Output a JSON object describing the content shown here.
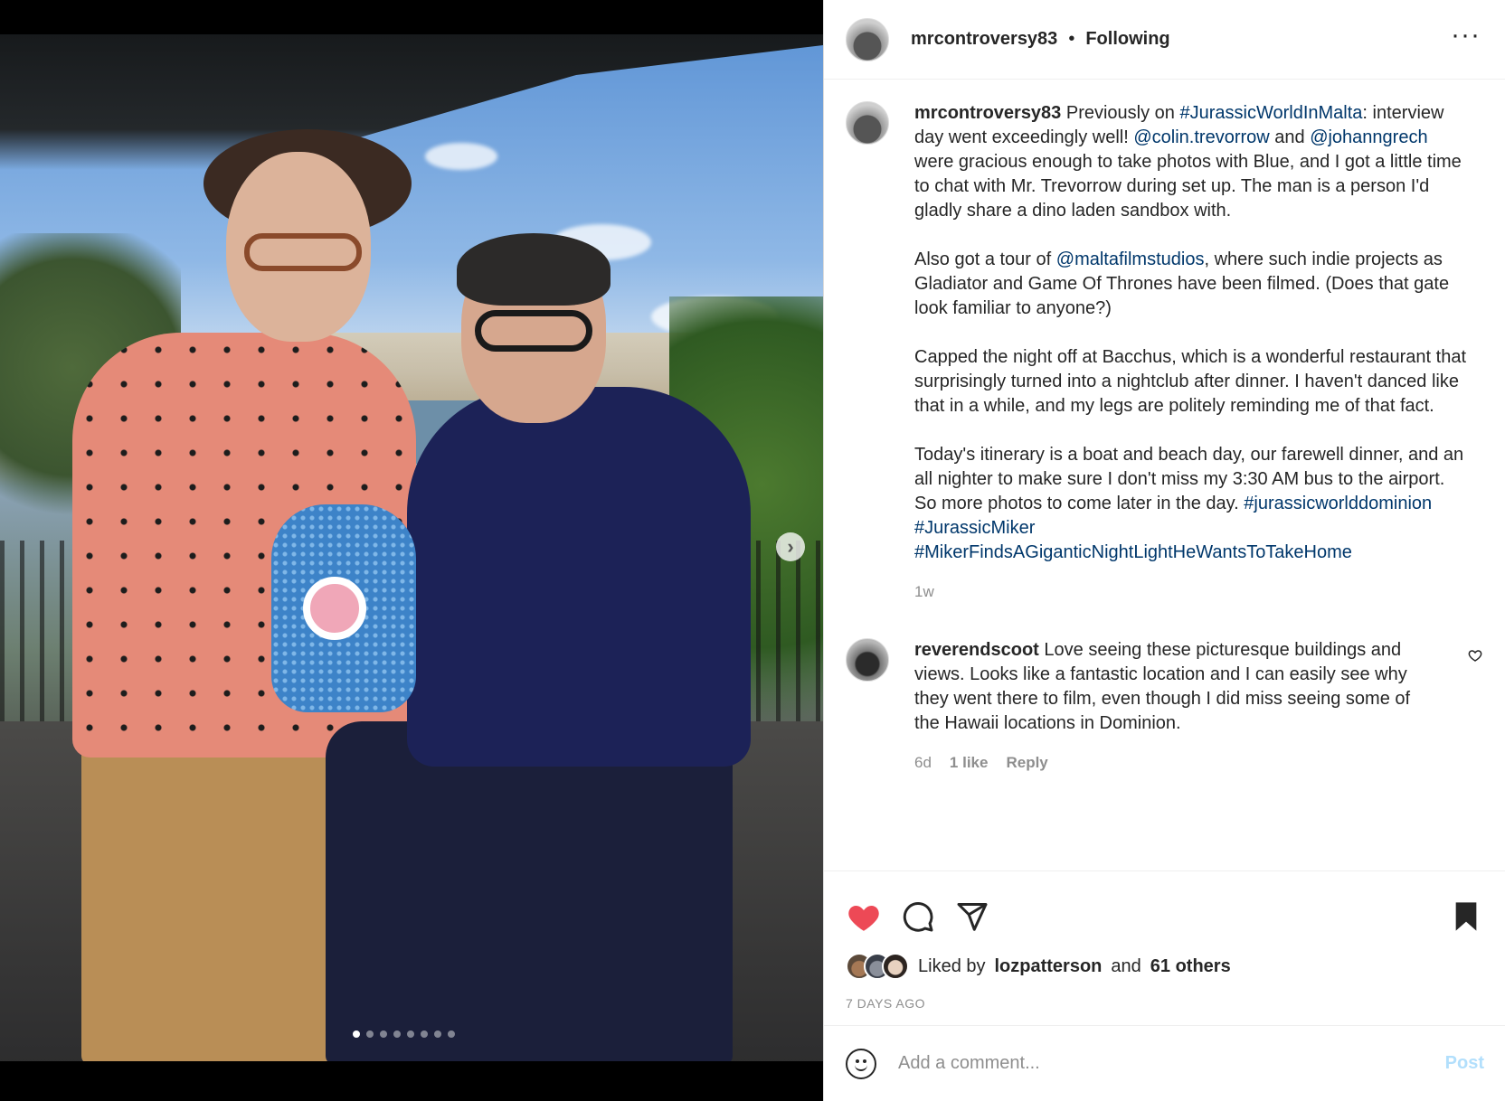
{
  "header": {
    "username": "mrcontroversy83",
    "separator": "•",
    "follow_status": "Following",
    "more_icon": "more-horizontal-icon"
  },
  "caption": {
    "username": "mrcontroversy83",
    "p1_a": " Previously on ",
    "p1_tag": "#JurassicWorldInMalta",
    "p1_b": ": interview day went exceedingly well! ",
    "p1_mention1": "@colin.trevorrow",
    "p1_c": " and ",
    "p1_mention2": "@johanngrech",
    "p1_d": " were gracious enough to take photos with Blue, and I got a little time to chat with Mr. Trevorrow during set up. The man is a person I'd gladly share a dino laden sandbox with.",
    "p2_a": "Also got a tour of ",
    "p2_mention": "@maltafilmstudios",
    "p2_b": ", where such indie projects as Gladiator and Game Of Thrones have been filmed. (Does that gate look familiar to anyone?)",
    "p3": "Capped the night off at Bacchus, which is a wonderful restaurant that surprisingly turned into a nightclub after dinner. I haven't danced like that in a while, and my legs are politely reminding me of that fact.",
    "p4": "Today's itinerary is a boat and beach day, our farewell dinner, and an all nighter to make sure I don't miss my 3:30 AM bus to the airport. So more photos to come later in the day.",
    "tag1": "#jurassicworlddominion",
    "tag2": "#JurassicMiker",
    "tag3": "#MikerFindsAGiganticNightLightHeWantsToTakeHome",
    "time": "1w"
  },
  "comment": {
    "username": "reverendscoot",
    "text": " Love seeing these picturesque buildings and views. Looks like a fantastic location and I can easily see why they went there to film, even though I did miss seeing some of the Hawaii locations in Dominion.",
    "time": "6d",
    "likes": "1 like",
    "reply": "Reply"
  },
  "actions": {
    "like_icon": "heart-filled-icon",
    "comment_icon": "comment-bubble-icon",
    "share_icon": "paper-plane-icon",
    "save_icon": "bookmark-filled-icon",
    "like_color": "#ed4956"
  },
  "likes": {
    "prefix": "Liked by",
    "user": "lozpatterson",
    "joiner": "and",
    "others": "61 others"
  },
  "post_date": "7 days ago",
  "add_comment": {
    "placeholder": "Add a comment...",
    "post_label": "Post"
  },
  "media": {
    "slide_count": 8,
    "active_slide": 1,
    "next_icon": "chevron-right-icon"
  }
}
